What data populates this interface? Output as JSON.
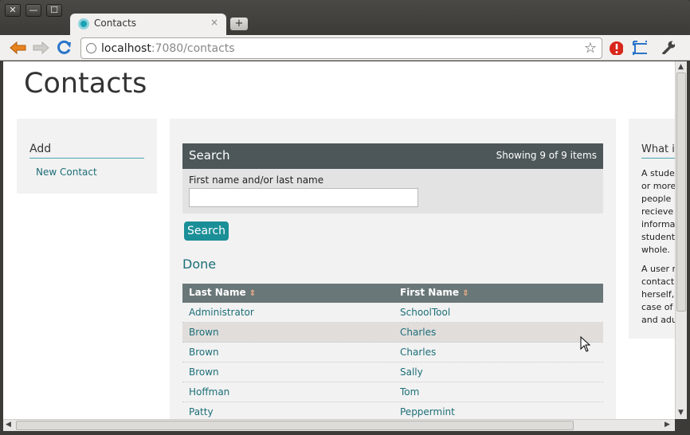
{
  "browser": {
    "tab_title": "Contacts",
    "tab_close": "×",
    "new_tab": "+",
    "url_host": "localhost",
    "url_rest": ":7080/contacts",
    "window_buttons": [
      "✕",
      "—",
      "☐"
    ]
  },
  "page": {
    "title": "Contacts",
    "sidebar": {
      "heading": "Add",
      "link": "New Contact"
    },
    "search": {
      "heading": "Search",
      "count": "Showing 9 of 9 items",
      "field_label": "First name and/or last name",
      "field_value": "",
      "button": "Search"
    },
    "done_label": "Done",
    "table": {
      "headers": [
        "Last Name",
        "First Name"
      ],
      "sort_icon": "⇕",
      "rows": [
        [
          "Administrator",
          "SchoolTool"
        ],
        [
          "Brown",
          "Charles"
        ],
        [
          "Brown",
          "Charles"
        ],
        [
          "Brown",
          "Sally"
        ],
        [
          "Hoffman",
          "Tom"
        ],
        [
          "Patty",
          "Peppermint"
        ]
      ]
    },
    "right_panel": {
      "heading": "What i",
      "para1": [
        "A stude",
        "or more",
        "people",
        "recieve",
        "informa",
        "student",
        "whole."
      ],
      "para2": [
        "A user r",
        "contact",
        "herself,",
        "case of",
        "and adu"
      ]
    }
  },
  "colors": {
    "accent": "#1a8f97",
    "link": "#1d6e78",
    "header": "#4d5759"
  }
}
